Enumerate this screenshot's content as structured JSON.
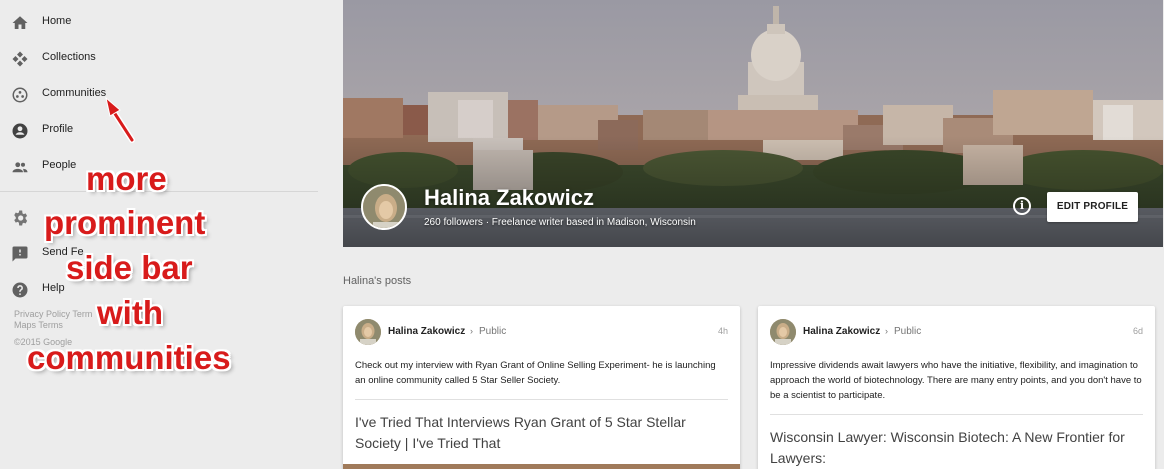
{
  "sidebar": {
    "items": [
      {
        "label": "Home",
        "icon": "home-icon"
      },
      {
        "label": "Collections",
        "icon": "collections-icon"
      },
      {
        "label": "Communities",
        "icon": "communities-icon"
      },
      {
        "label": "Profile",
        "icon": "profile-icon"
      },
      {
        "label": "People",
        "icon": "people-icon"
      },
      {
        "label": "",
        "icon": "settings-icon"
      },
      {
        "label": "Send Fe",
        "icon": "feedback-icon"
      },
      {
        "label": "Help",
        "icon": "help-icon"
      }
    ],
    "footer": {
      "privacy": "Privacy Policy",
      "terms": "Term",
      "maps_terms": "Maps Terms",
      "copyright": "©2015 Google"
    }
  },
  "annotation": {
    "lines": [
      "more",
      "prominent",
      "side bar",
      "with",
      "communities"
    ],
    "color": "#d81b1b"
  },
  "profile": {
    "name": "Halina Zakowicz",
    "subtitle": "260 followers · Freelance writer based in Madison, Wisconsin",
    "info_icon": "info-icon",
    "edit_button": "EDIT PROFILE"
  },
  "posts_heading": "Halina's posts",
  "posts": [
    {
      "author": "Halina Zakowicz",
      "visibility": "Public",
      "time": "4h",
      "text": "Check out my interview with Ryan Grant of Online Selling Experiment- he is launching an online community called 5 Star Seller Society.",
      "link_title": "I've Tried That Interviews Ryan Grant of 5 Star Stellar Society | I've Tried That"
    },
    {
      "author": "Halina Zakowicz",
      "visibility": "Public",
      "time": "6d",
      "text": "Impressive dividends await lawyers who have the initiative, flexibility, and imagination to approach the world of biotechnology. There are many entry points, and you don't have to be a scientist to participate.",
      "link_title": "Wisconsin Lawyer: Wisconsin Biotech: A New Frontier for Lawyers:"
    }
  ],
  "colors": {
    "sidebar_bg": "#ececec",
    "page_bg": "#ececec",
    "annotation": "#d81b1b",
    "card_bg": "#ffffff"
  }
}
